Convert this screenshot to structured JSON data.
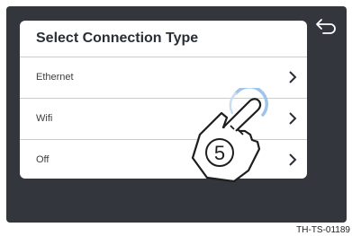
{
  "panel": {
    "title": "Select Connection Type",
    "options": [
      {
        "label": "Ethernet"
      },
      {
        "label": "Wifi"
      },
      {
        "label": "Off"
      }
    ]
  },
  "callout": {
    "step": "5"
  },
  "caption": "TH-TS-01189",
  "icons": {
    "back": "back-arrow-icon",
    "chevron": "chevron-right-icon",
    "hand": "tap-hand-icon"
  },
  "colors": {
    "screen": "#33363c",
    "panel": "#ffffff",
    "text": "#2a2e36",
    "tap_ring": "#9ec4ea"
  }
}
